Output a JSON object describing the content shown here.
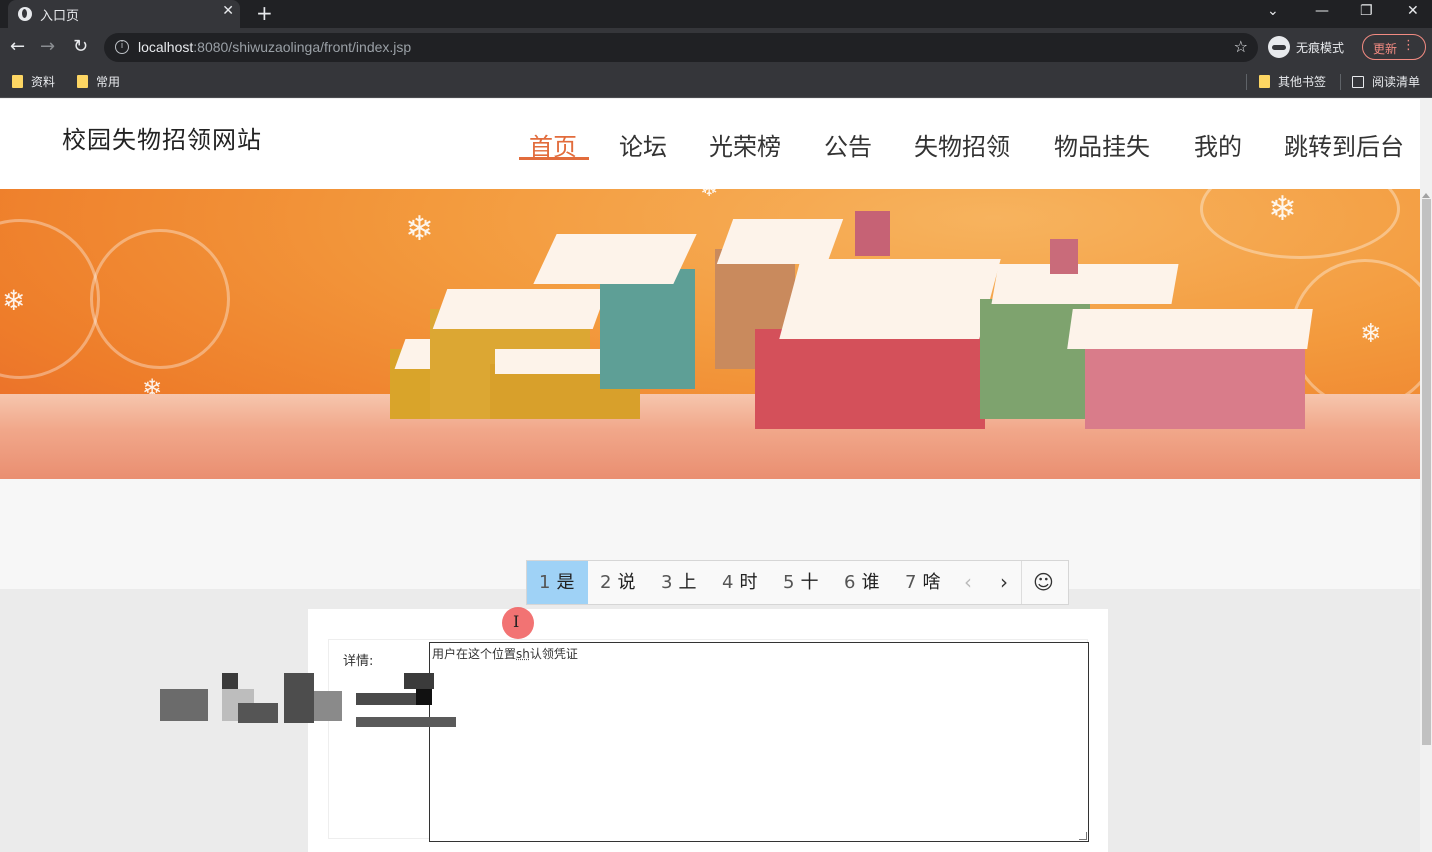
{
  "browser": {
    "tab_title": "入口页",
    "url_host": "localhost",
    "url_rest": ":8080/shiwuzaolinga/front/index.jsp",
    "profile_label": "无痕模式",
    "update_label": "更新",
    "bookmarks": [
      {
        "label": "资料"
      },
      {
        "label": "常用"
      }
    ],
    "bookmarks_right": [
      {
        "label": "其他书签"
      },
      {
        "label": "阅读清单"
      }
    ]
  },
  "site": {
    "title": "校园失物招领网站",
    "nav": [
      {
        "label": "首页",
        "active": true
      },
      {
        "label": "论坛"
      },
      {
        "label": "光荣榜"
      },
      {
        "label": "公告"
      },
      {
        "label": "失物招领"
      },
      {
        "label": "物品挂失"
      },
      {
        "label": "我的"
      },
      {
        "label": "跳转到后台"
      }
    ],
    "accent_color": "#e26c3c"
  },
  "form": {
    "detail_label": "详情:",
    "detail_text_before": "用户在这个位置",
    "detail_ime_composition": "sh",
    "detail_text_after": "认领凭证"
  },
  "ime": {
    "candidates": [
      {
        "num": "1",
        "text": "是",
        "selected": true
      },
      {
        "num": "2",
        "text": "说"
      },
      {
        "num": "3",
        "text": "上"
      },
      {
        "num": "4",
        "text": "时"
      },
      {
        "num": "5",
        "text": "十"
      },
      {
        "num": "6",
        "text": "谁"
      },
      {
        "num": "7",
        "text": "啥"
      }
    ],
    "prev_icon": "‹",
    "next_icon": "›",
    "emoji_icon": "☺"
  }
}
